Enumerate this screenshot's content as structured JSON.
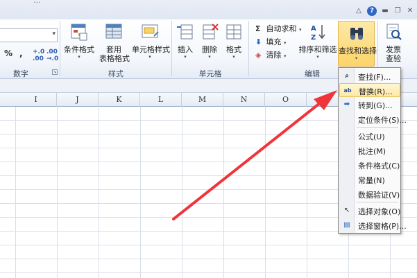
{
  "window": {
    "title_fragment": "...",
    "help": "?"
  },
  "ribbon": {
    "groups": {
      "number": "数字",
      "styles": "样式",
      "cells": "单元格",
      "editing": "编辑"
    },
    "number": {
      "percent": "%",
      "comma": ",",
      "inc_decimal": ".0→.00",
      "dec_decimal": ".00→.0"
    },
    "styles": {
      "conditional_format": "条件格式",
      "format_table_1": "套用",
      "format_table_2": "表格格式",
      "cell_styles": "单元格样式"
    },
    "cells": {
      "insert": "插入",
      "delete": "删除",
      "format": "格式"
    },
    "editing": {
      "autosum": "自动求和",
      "fill": "填充",
      "clear": "清除",
      "sort_filter": "排序和筛选",
      "find_select": "查找和选择"
    },
    "invoice": {
      "line1": "发票",
      "line2": "查验"
    }
  },
  "columns": [
    "I",
    "J",
    "K",
    "L",
    "M",
    "N",
    "O"
  ],
  "find_menu": {
    "items": [
      {
        "label": "查找(F)...",
        "icon": "binoculars-icon"
      },
      {
        "label": "替换(R)...",
        "icon": "replace-icon",
        "highlighted": true
      },
      {
        "label": "转到(G)...",
        "icon": "arrow-right-icon"
      },
      {
        "label": "定位条件(S)...",
        "icon": ""
      },
      {
        "label": "公式(U)",
        "icon": ""
      },
      {
        "label": "批注(M)",
        "icon": ""
      },
      {
        "label": "条件格式(C)",
        "icon": ""
      },
      {
        "label": "常量(N)",
        "icon": ""
      },
      {
        "label": "数据验证(V)",
        "icon": ""
      },
      {
        "label": "选择对象(O)",
        "icon": "pointer-icon"
      },
      {
        "label": "选择窗格(P)...",
        "icon": "selection-pane-icon"
      }
    ]
  },
  "colors": {
    "annotation_arrow": "#f0353a",
    "menu_highlight": "#fde8a4",
    "active_button": "#fbd46a"
  }
}
